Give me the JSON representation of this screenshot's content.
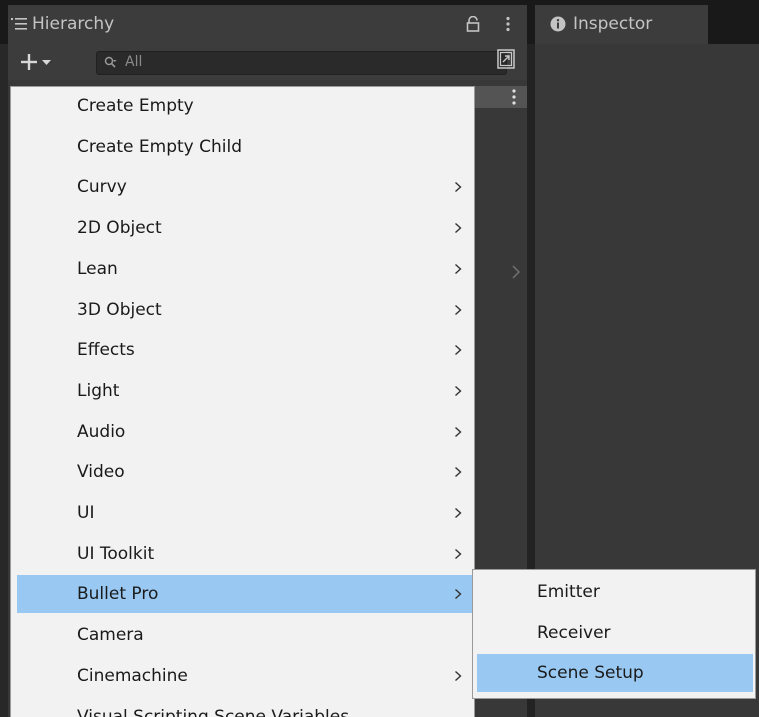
{
  "tabs": {
    "hierarchy": {
      "label": "Hierarchy"
    },
    "inspector": {
      "label": "Inspector"
    }
  },
  "toolbar": {
    "search_placeholder": "All"
  },
  "icons": {
    "tab_hierarchy": "list-icon",
    "tab_inspector": "info-icon",
    "lock": "lock-icon",
    "kebab": "kebab-menu-icon",
    "add": "plus-icon",
    "add_dropdown": "caret-down-icon",
    "search": "search-icon",
    "toggle": "scene-visibility-toggle-icon",
    "submenu_arrow": "chevron-right-icon"
  },
  "colors": {
    "highlight": "#99c9f2",
    "menu_bg": "#f2f2f2",
    "panel_bg": "#383838"
  },
  "context_menu": {
    "items": [
      {
        "label": "Create Empty",
        "has_submenu": false,
        "highlighted": false
      },
      {
        "label": "Create Empty Child",
        "has_submenu": false,
        "highlighted": false
      },
      {
        "label": "Curvy",
        "has_submenu": true,
        "highlighted": false
      },
      {
        "label": "2D Object",
        "has_submenu": true,
        "highlighted": false
      },
      {
        "label": "Lean",
        "has_submenu": true,
        "highlighted": false
      },
      {
        "label": "3D Object",
        "has_submenu": true,
        "highlighted": false
      },
      {
        "label": "Effects",
        "has_submenu": true,
        "highlighted": false
      },
      {
        "label": "Light",
        "has_submenu": true,
        "highlighted": false
      },
      {
        "label": "Audio",
        "has_submenu": true,
        "highlighted": false
      },
      {
        "label": "Video",
        "has_submenu": true,
        "highlighted": false
      },
      {
        "label": "UI",
        "has_submenu": true,
        "highlighted": false
      },
      {
        "label": "UI Toolkit",
        "has_submenu": true,
        "highlighted": false
      },
      {
        "label": "Bullet Pro",
        "has_submenu": true,
        "highlighted": true
      },
      {
        "label": "Camera",
        "has_submenu": false,
        "highlighted": false
      },
      {
        "label": "Cinemachine",
        "has_submenu": true,
        "highlighted": false
      },
      {
        "label": "Visual Scripting Scene Variables",
        "has_submenu": false,
        "highlighted": false
      }
    ]
  },
  "submenu": {
    "items": [
      {
        "label": "Emitter",
        "highlighted": false
      },
      {
        "label": "Receiver",
        "highlighted": false
      },
      {
        "label": "Scene Setup",
        "highlighted": true
      }
    ]
  }
}
